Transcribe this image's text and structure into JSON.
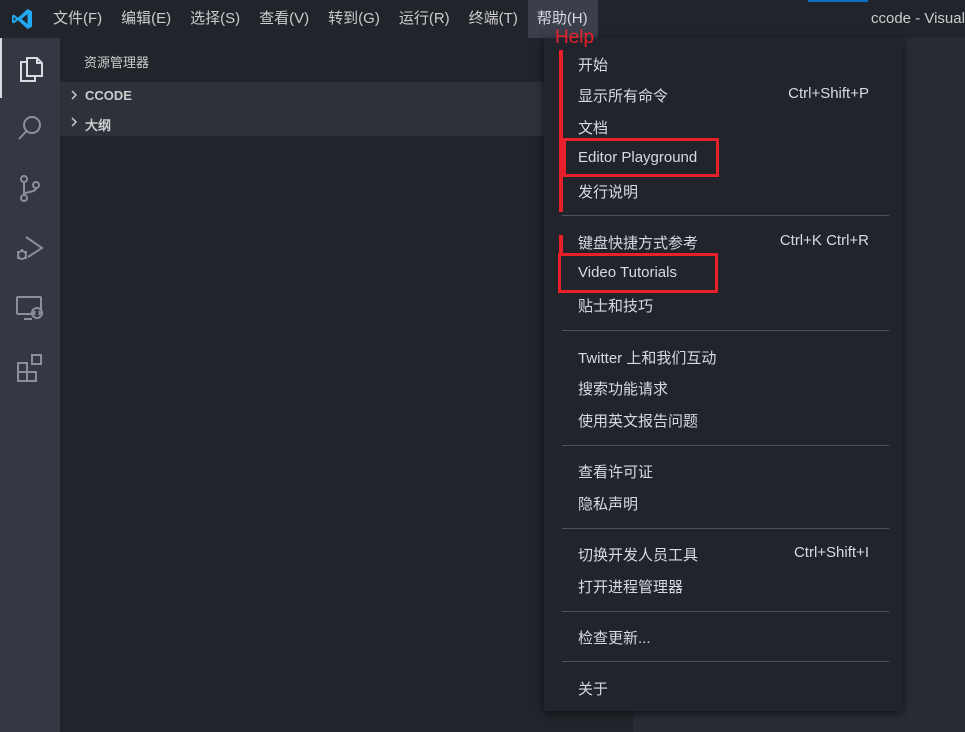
{
  "titlebar": {
    "menus": [
      "文件(F)",
      "编辑(E)",
      "选择(S)",
      "查看(V)",
      "转到(G)",
      "运行(R)",
      "终端(T)",
      "帮助(H)"
    ],
    "window_title": "ccode - Visual"
  },
  "activitybar": {
    "icons": [
      "explorer-icon",
      "search-icon",
      "source-control-icon",
      "run-debug-icon",
      "remote-explorer-icon",
      "extensions-icon"
    ]
  },
  "sidebar": {
    "title": "资源管理器",
    "sections": [
      {
        "label": "CCODE"
      },
      {
        "label": "大纲"
      }
    ]
  },
  "help_menu": {
    "items": [
      {
        "label": "开始",
        "shortcut": ""
      },
      {
        "label": "显示所有命令",
        "shortcut": "Ctrl+Shift+P"
      },
      {
        "label": "文档",
        "shortcut": ""
      },
      {
        "label": "Editor Playground",
        "shortcut": ""
      },
      {
        "label": "发行说明",
        "shortcut": ""
      },
      {
        "label": "键盘快捷方式参考",
        "shortcut": "Ctrl+K Ctrl+R"
      },
      {
        "label": "Video Tutorials",
        "shortcut": ""
      },
      {
        "label": "贴士和技巧",
        "shortcut": ""
      },
      {
        "label": "Twitter 上和我们互动",
        "shortcut": ""
      },
      {
        "label": "搜索功能请求",
        "shortcut": ""
      },
      {
        "label": "使用英文报告问题",
        "shortcut": ""
      },
      {
        "label": "查看许可证",
        "shortcut": ""
      },
      {
        "label": "隐私声明",
        "shortcut": ""
      },
      {
        "label": "切换开发人员工具",
        "shortcut": "Ctrl+Shift+I"
      },
      {
        "label": "打开进程管理器",
        "shortcut": ""
      },
      {
        "label": "检查更新...",
        "shortcut": ""
      },
      {
        "label": "关于",
        "shortcut": ""
      }
    ]
  },
  "annotation": {
    "label": "Help",
    "color": "#e8202a"
  },
  "colors": {
    "accent": "#0e70c0",
    "menu_bg": "#21252b",
    "activitybar_bg": "#333842"
  }
}
